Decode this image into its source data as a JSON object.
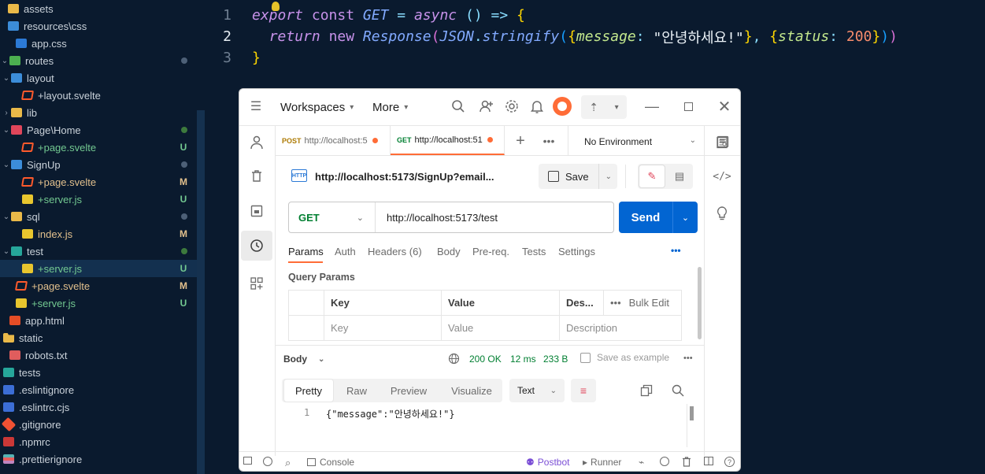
{
  "explorer": {
    "items": [
      {
        "label": "assets",
        "status": ""
      },
      {
        "label": "resources\\css",
        "status": ""
      },
      {
        "label": "app.css",
        "status": ""
      },
      {
        "label": "routes",
        "status": ""
      },
      {
        "label": "layout",
        "status": ""
      },
      {
        "label": "+layout.svelte",
        "status": ""
      },
      {
        "label": "lib",
        "status": ""
      },
      {
        "label": "Page\\Home",
        "status": ""
      },
      {
        "label": "+page.svelte",
        "status": "U"
      },
      {
        "label": "SignUp",
        "status": ""
      },
      {
        "label": "+page.svelte",
        "status": "M"
      },
      {
        "label": "+server.js",
        "status": "U"
      },
      {
        "label": "sql",
        "status": ""
      },
      {
        "label": "index.js",
        "status": "M"
      },
      {
        "label": "test",
        "status": ""
      },
      {
        "label": "+server.js",
        "status": "U"
      },
      {
        "label": "+page.svelte",
        "status": "M"
      },
      {
        "label": "+server.js",
        "status": "U"
      },
      {
        "label": "app.html",
        "status": ""
      },
      {
        "label": "static",
        "status": ""
      },
      {
        "label": "robots.txt",
        "status": ""
      },
      {
        "label": "tests",
        "status": ""
      },
      {
        "label": ".eslintignore",
        "status": ""
      },
      {
        "label": ".eslintrc.cjs",
        "status": ""
      },
      {
        "label": ".gitignore",
        "status": ""
      },
      {
        "label": ".npmrc",
        "status": ""
      },
      {
        "label": ".prettierignore",
        "status": ""
      }
    ]
  },
  "editor": {
    "line_numbers": [
      "1",
      "2",
      "3"
    ],
    "line1": {
      "export": "export",
      "const": "const",
      "name": "GET",
      "eq": "=",
      "async": "async",
      "arrow": "() =>",
      "brace": "{"
    },
    "line2": {
      "return": "return",
      "new": "new",
      "cls": "Response",
      "json": "JSON",
      "dot": ".",
      "method": "stringify",
      "key1": "message",
      "val1": "\"안녕하세요!\"",
      "key2": "status",
      "val2": "200"
    },
    "line3": {
      "brace": "}"
    }
  },
  "postman": {
    "header": {
      "workspaces": "Workspaces",
      "more": "More"
    },
    "tabs": [
      {
        "method": "POST",
        "url": "http://localhost:5",
        "method_color": "#ad7a03"
      },
      {
        "method": "GET",
        "url": "http://localhost:51",
        "method_color": "#007f31"
      }
    ],
    "environment": "No Environment",
    "request_name": "http://localhost:5173/SignUp?email...",
    "save_label": "Save",
    "http_badge": "HTTP",
    "method": "GET",
    "url": "http://localhost:5173/test",
    "send_label": "Send",
    "request_tabs": {
      "params": "Params",
      "auth": "Auth",
      "headers": "Headers",
      "headers_count": "(6)",
      "body": "Body",
      "prereq": "Pre-req.",
      "tests": "Tests",
      "settings": "Settings"
    },
    "query_params": {
      "title": "Query Params",
      "col_key": "Key",
      "col_value": "Value",
      "col_desc": "Des...",
      "bulk_edit": "Bulk Edit",
      "ph_key": "Key",
      "ph_value": "Value",
      "ph_desc": "Description"
    },
    "response": {
      "body_label": "Body",
      "status": "200 OK",
      "time": "12 ms",
      "size": "233 B",
      "save_example": "Save as example",
      "tabs": {
        "pretty": "Pretty",
        "raw": "Raw",
        "preview": "Preview",
        "visualize": "Visualize"
      },
      "format": "Text",
      "line_no": "1",
      "body_text": "{\"message\":\"안녕하세요!\"}"
    },
    "footer": {
      "console": "Console",
      "postbot": "Postbot",
      "runner": "Runner"
    },
    "colors": {
      "accent": "#ff6c37",
      "send": "#0265d2",
      "green": "#007f31"
    }
  }
}
